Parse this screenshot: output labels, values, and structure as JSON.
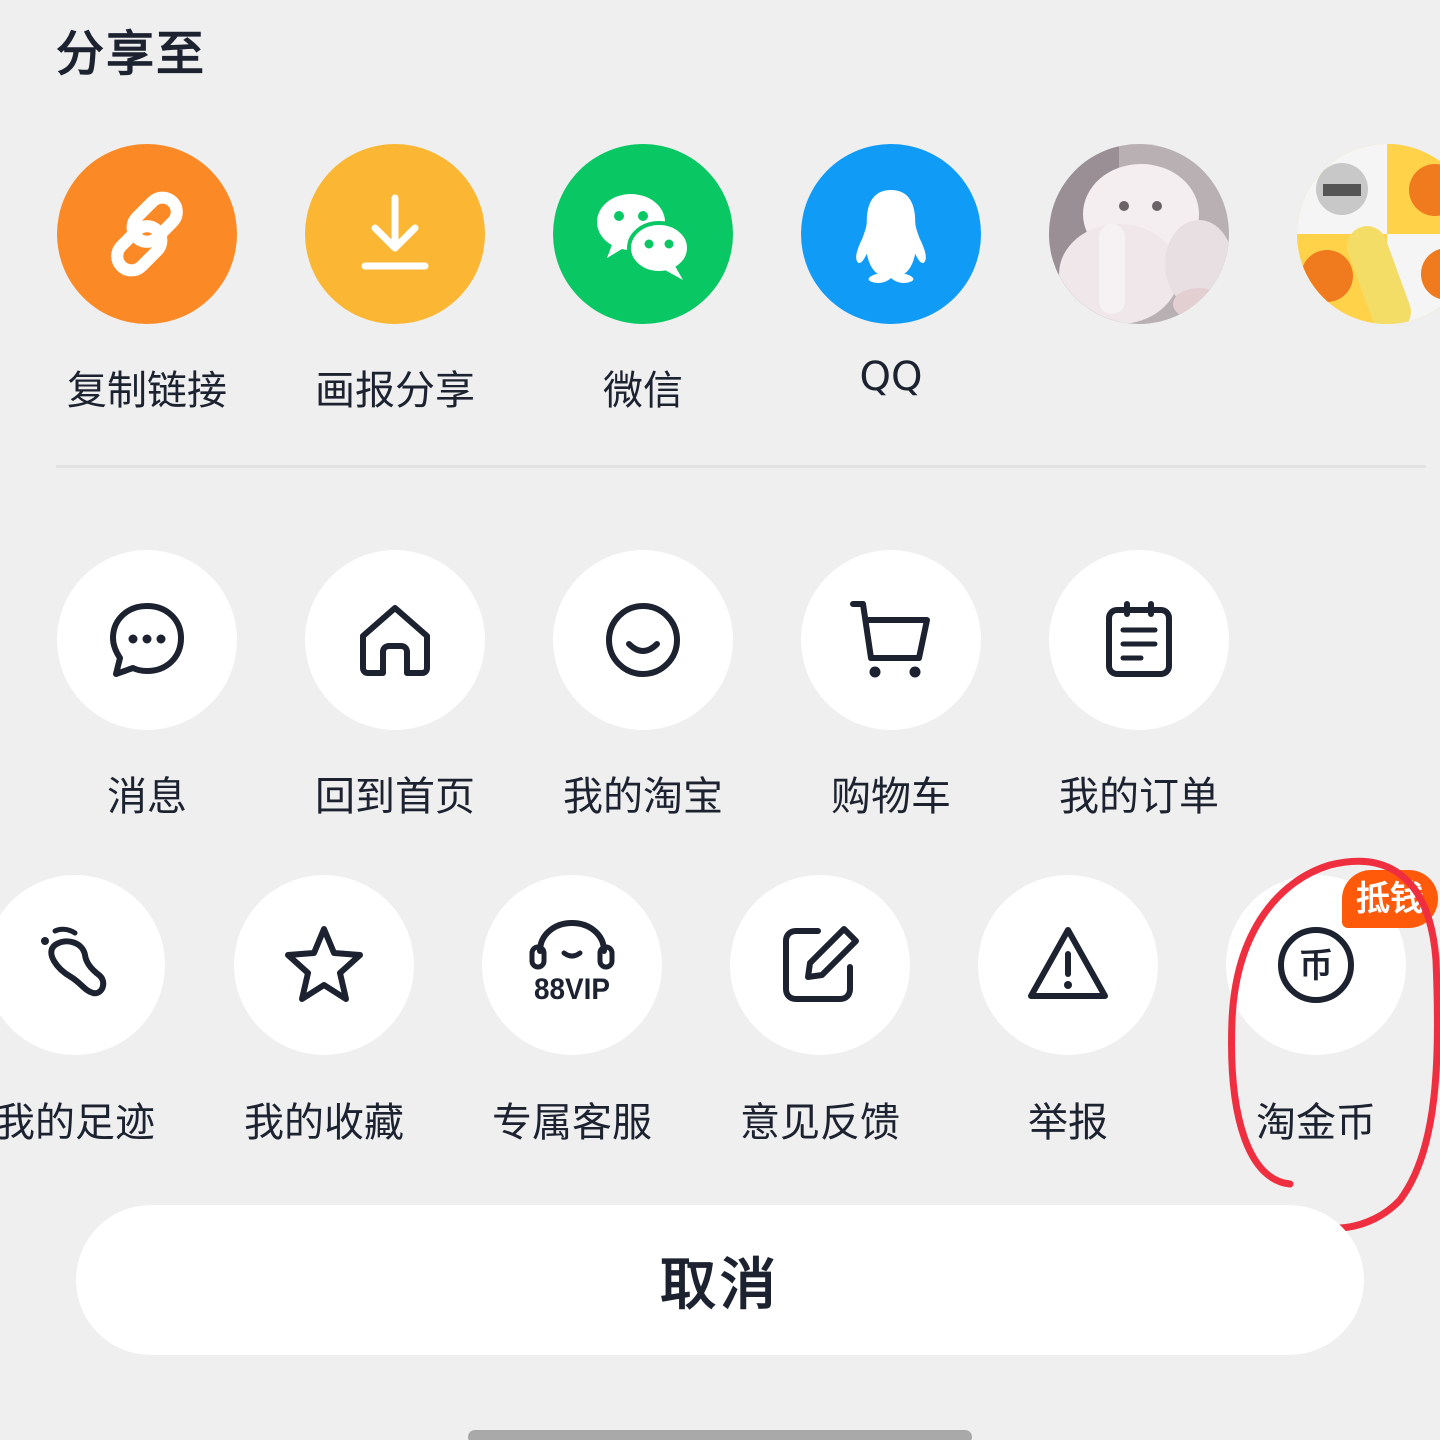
{
  "share_title": "分享至",
  "share_targets": [
    {
      "label": "复制链接",
      "icon": "link-icon",
      "color": "#fb8a26"
    },
    {
      "label": "画报分享",
      "icon": "download-icon",
      "color": "#fbb733"
    },
    {
      "label": "微信",
      "icon": "wechat-icon",
      "color": "#09c864"
    },
    {
      "label": "QQ",
      "icon": "qq-penguin-icon",
      "color": "#0f9bf6"
    },
    {
      "label": "",
      "icon": "contact-avatar-cat"
    },
    {
      "label": "",
      "icon": "contact-avatar-cartoon"
    }
  ],
  "menu_row1": [
    {
      "label": "消息",
      "icon": "message-icon"
    },
    {
      "label": "回到首页",
      "icon": "home-icon"
    },
    {
      "label": "我的淘宝",
      "icon": "smile-icon"
    },
    {
      "label": "购物车",
      "icon": "cart-icon"
    },
    {
      "label": "我的订单",
      "icon": "order-icon"
    }
  ],
  "menu_row2": [
    {
      "label": "我的足迹",
      "icon": "footprint-icon"
    },
    {
      "label": "我的收藏",
      "icon": "star-icon"
    },
    {
      "label": "专属客服",
      "icon": "88vip-headset-icon",
      "icon_text": "88VIP"
    },
    {
      "label": "意见反馈",
      "icon": "edit-icon"
    },
    {
      "label": "举报",
      "icon": "warning-icon"
    },
    {
      "label": "淘金币",
      "icon": "coin-icon",
      "icon_text": "币",
      "badge": "抵钱"
    }
  ],
  "cancel_label": "取消",
  "colors": {
    "background": "#efefef",
    "text": "#1c2230",
    "badge": "#ff5a0a",
    "annotation": "#ef2f3f"
  }
}
